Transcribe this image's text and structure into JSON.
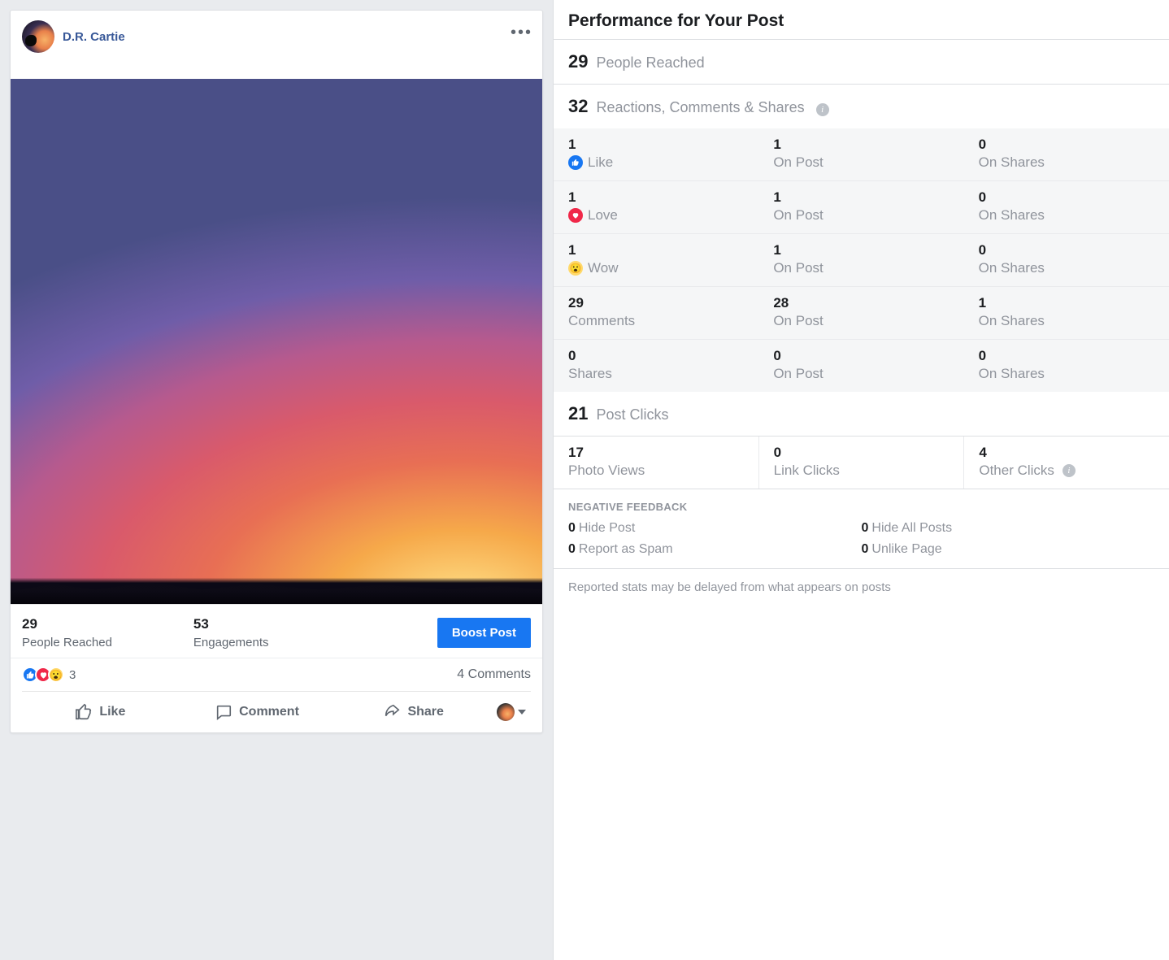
{
  "post": {
    "author": "D.R. Cartie",
    "reached": {
      "num": "29",
      "label": "People Reached"
    },
    "engagements": {
      "num": "53",
      "label": "Engagements"
    },
    "boost_label": "Boost Post",
    "reaction_count": "3",
    "comments_text": "4 Comments",
    "actions": {
      "like": "Like",
      "comment": "Comment",
      "share": "Share"
    }
  },
  "perf": {
    "title": "Performance for Your Post",
    "reached": {
      "num": "29",
      "label": "People Reached"
    },
    "rcs": {
      "num": "32",
      "label": "Reactions, Comments & Shares"
    },
    "rows": [
      {
        "a_n": "1",
        "a_l": "Like",
        "icon": "like",
        "b_n": "1",
        "b_l": "On Post",
        "c_n": "0",
        "c_l": "On Shares"
      },
      {
        "a_n": "1",
        "a_l": "Love",
        "icon": "love",
        "b_n": "1",
        "b_l": "On Post",
        "c_n": "0",
        "c_l": "On Shares"
      },
      {
        "a_n": "1",
        "a_l": "Wow",
        "icon": "wow",
        "b_n": "1",
        "b_l": "On Post",
        "c_n": "0",
        "c_l": "On Shares"
      },
      {
        "a_n": "29",
        "a_l": "Comments",
        "icon": "",
        "b_n": "28",
        "b_l": "On Post",
        "c_n": "1",
        "c_l": "On Shares"
      },
      {
        "a_n": "0",
        "a_l": "Shares",
        "icon": "",
        "b_n": "0",
        "b_l": "On Post",
        "c_n": "0",
        "c_l": "On Shares"
      }
    ],
    "clicks": {
      "num": "21",
      "label": "Post Clicks",
      "cols": [
        {
          "n": "17",
          "l": "Photo Views"
        },
        {
          "n": "0",
          "l": "Link Clicks"
        },
        {
          "n": "4",
          "l": "Other Clicks",
          "info": true
        }
      ]
    },
    "negative": {
      "title": "NEGATIVE FEEDBACK",
      "items": [
        {
          "n": "0",
          "l": "Hide Post"
        },
        {
          "n": "0",
          "l": "Hide All Posts"
        },
        {
          "n": "0",
          "l": "Report as Spam"
        },
        {
          "n": "0",
          "l": "Unlike Page"
        }
      ]
    },
    "footnote": "Reported stats may be delayed from what appears on posts"
  }
}
